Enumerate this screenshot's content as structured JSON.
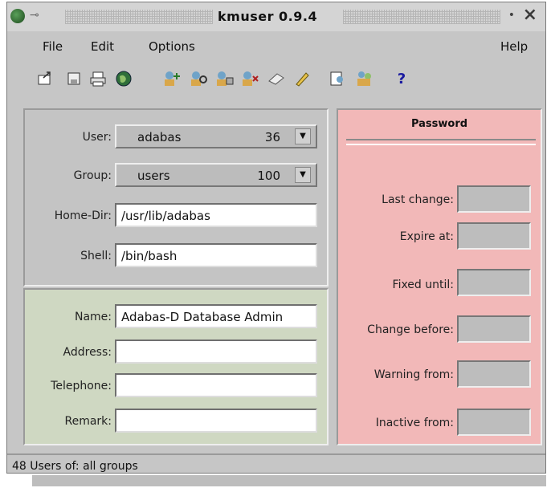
{
  "window": {
    "title": "kmuser  0.9.4"
  },
  "menu": {
    "file": "File",
    "edit": "Edit",
    "options": "Options",
    "help": "Help"
  },
  "toolbar": {
    "help_glyph": "?"
  },
  "user": {
    "label": "User:",
    "value": "adabas",
    "id": "36"
  },
  "group": {
    "label": "Group:",
    "value": "users",
    "id": "100"
  },
  "home": {
    "label": "Home-Dir:",
    "value": "/usr/lib/adabas"
  },
  "shell": {
    "label": "Shell:",
    "value": "/bin/bash"
  },
  "name": {
    "label": "Name:",
    "value": "Adabas-D Database Admin"
  },
  "address": {
    "label": "Address:",
    "value": ""
  },
  "telephone": {
    "label": "Telephone:",
    "value": ""
  },
  "remark": {
    "label": "Remark:",
    "value": ""
  },
  "password": {
    "title": "Password",
    "last_change": "Last change:",
    "expire_at": "Expire at:",
    "fixed_until": "Fixed until:",
    "change_before": "Change before:",
    "warning_from": "Warning from:",
    "inactive_from": "Inactive from:"
  },
  "status": {
    "text": "48 Users of:  all groups"
  },
  "colors": {
    "user_panel": "#c4c4c4",
    "name_panel": "#cfd8c2",
    "password_panel": "#f2b8b8"
  }
}
